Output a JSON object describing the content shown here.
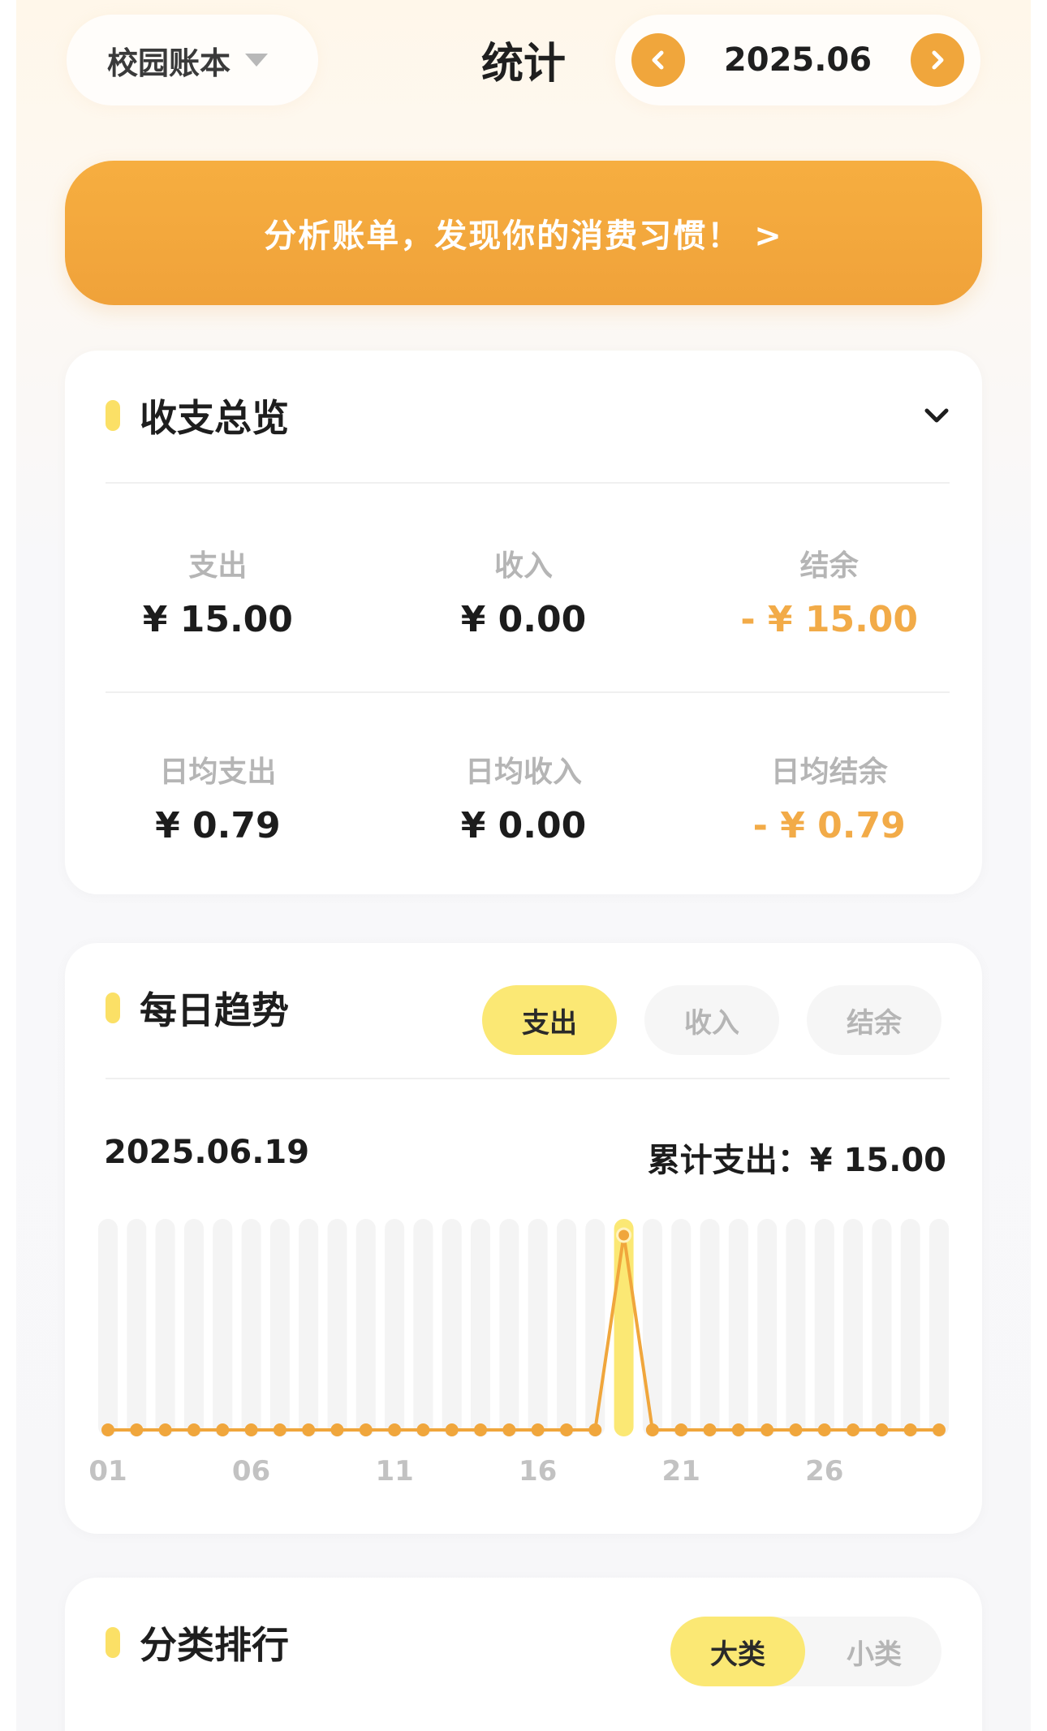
{
  "header": {
    "book_name": "校园账本",
    "title": "统计",
    "month": "2025.06"
  },
  "banner": {
    "text": "分析账单，发现你的消费习惯！ >"
  },
  "overview": {
    "title": "收支总览",
    "row1": [
      {
        "label": "支出",
        "value": "¥ 15.00",
        "negative": false
      },
      {
        "label": "收入",
        "value": "¥ 0.00",
        "negative": false
      },
      {
        "label": "结余",
        "value": "- ¥ 15.00",
        "negative": true
      }
    ],
    "row2": [
      {
        "label": "日均支出",
        "value": "¥ 0.79",
        "negative": false
      },
      {
        "label": "日均收入",
        "value": "¥ 0.00",
        "negative": false
      },
      {
        "label": "日均结余",
        "value": "- ¥ 0.79",
        "negative": true
      }
    ]
  },
  "trend": {
    "title": "每日趋势",
    "tabs": [
      "支出",
      "收入",
      "结余"
    ],
    "selected_date": "2025.06.19",
    "total": "累计支出：¥ 15.00"
  },
  "ranking": {
    "title": "分类排行",
    "tabs": [
      "大类",
      "小类"
    ]
  },
  "colors": {
    "accent": "#f0a63c",
    "highlight": "#fbe874",
    "negative": "#f2ab48"
  },
  "chart_data": {
    "type": "line",
    "x": [
      "01",
      "02",
      "03",
      "04",
      "05",
      "06",
      "07",
      "08",
      "09",
      "10",
      "11",
      "12",
      "13",
      "14",
      "15",
      "16",
      "17",
      "18",
      "19",
      "20",
      "21",
      "22",
      "23",
      "24",
      "25",
      "26",
      "27",
      "28",
      "29",
      "30"
    ],
    "x_tick_labels": [
      "01",
      "06",
      "11",
      "16",
      "21",
      "26"
    ],
    "series": [
      {
        "values": [
          0,
          0,
          0,
          0,
          0,
          0,
          0,
          0,
          0,
          0,
          0,
          0,
          0,
          0,
          0,
          0,
          0,
          0,
          15,
          0,
          0,
          0,
          0,
          0,
          0,
          0,
          0,
          0,
          0,
          0
        ]
      }
    ],
    "highlight_index": 18,
    "ylim": [
      0,
      15
    ]
  }
}
